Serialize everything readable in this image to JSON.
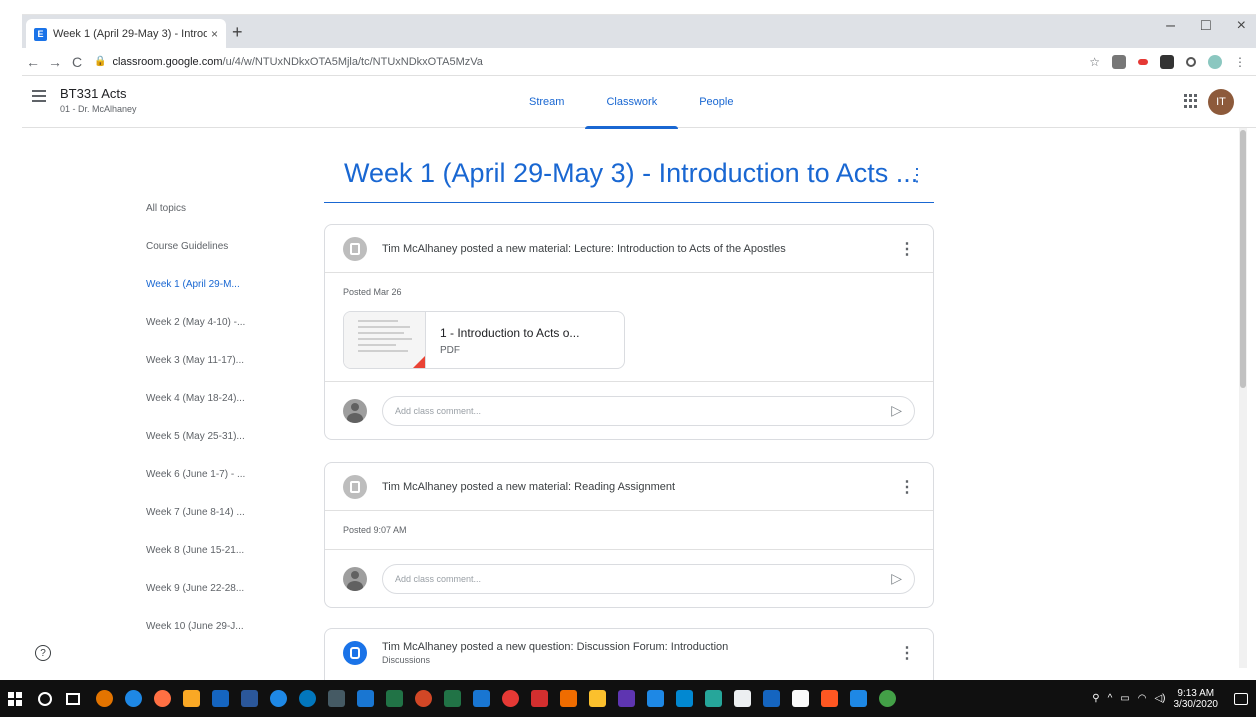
{
  "browser": {
    "tab_title": "Week 1 (April 29-May 3) - Introd",
    "tab_close": "×",
    "new_tab": "+",
    "favicon_letter": "E",
    "win_minimize": "–",
    "win_restore": "□",
    "win_close": "×",
    "back": "←",
    "forward": "→",
    "reload": "C",
    "url_domain": "classroom.google.com",
    "url_path": "/u/4/w/NTUxNDkxOTA5Mjla/tc/NTUxNDkxOTA5MzVa",
    "bookmark": "☆"
  },
  "classroom": {
    "class_name": "BT331 Acts",
    "class_section": "01 - Dr. McAlhaney",
    "tabs": [
      {
        "label": "Stream"
      },
      {
        "label": "Classwork"
      },
      {
        "label": "People"
      }
    ],
    "active_tab": "Classwork",
    "avatar_initials": "IT"
  },
  "topics": [
    {
      "label": "All topics"
    },
    {
      "label": "Course Guidelines"
    },
    {
      "label": "Week 1 (April 29-M..."
    },
    {
      "label": "Week 2 (May 4-10) -..."
    },
    {
      "label": "Week 3 (May 11-17)..."
    },
    {
      "label": "Week 4 (May 18-24)..."
    },
    {
      "label": "Week 5 (May 25-31)..."
    },
    {
      "label": "Week 6 (June 1-7) - ..."
    },
    {
      "label": "Week 7 (June 8-14) ..."
    },
    {
      "label": "Week 8 (June 15-21..."
    },
    {
      "label": "Week 9 (June 22-28..."
    },
    {
      "label": "Week 10 (June 29-J..."
    }
  ],
  "main": {
    "heading": "Week 1 (April 29-May 3) - Introduction to Acts ...",
    "more": "⋮",
    "posts": [
      {
        "title": "Tim McAlhaney posted a new material: Lecture: Introduction to Acts of the Apostles",
        "posted": "Posted Mar 26",
        "attachment_name": "1 - Introduction to Acts o...",
        "attachment_type": "PDF",
        "comment_placeholder": "Add class comment..."
      },
      {
        "title": "Tim McAlhaney posted a new material: Reading Assignment",
        "posted": "Posted 9:07 AM",
        "comment_placeholder": "Add class comment..."
      },
      {
        "title": "Tim McAlhaney posted a new question: Discussion Forum: Introduction",
        "subtitle": "Discussions"
      }
    ]
  },
  "help": "?",
  "taskbar": {
    "time": "9:13 AM",
    "date": "3/30/2020"
  },
  "colors": {
    "accent": "#1967d2",
    "avatar_bg": "#8d5a3b",
    "taskbar_bg": "#101010"
  }
}
